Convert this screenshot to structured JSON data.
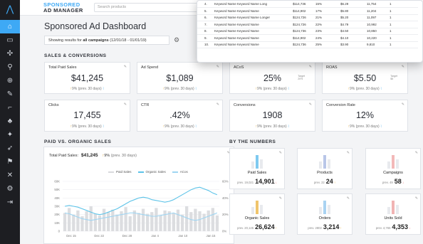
{
  "sidebar": {
    "icons": [
      "home-icon",
      "monitor-icon",
      "network-icon",
      "search-icon",
      "target-icon",
      "wrench-icon",
      "telescope-icon",
      "tree-icon",
      "bookmark-icon",
      "rocket-icon",
      "flag-icon",
      "split-icon",
      "gear-icon",
      "exit-icon"
    ]
  },
  "brand": {
    "line1": "SPONSORED",
    "line2": "AD MANAGER"
  },
  "search": {
    "placeholder": "Search products"
  },
  "page": {
    "title": "Sponsored Ad Dashboard",
    "range_prefix": "Showing results for",
    "range_bold": "all campaigns",
    "range_dates": "(12/01/18 - 01/01/19)"
  },
  "sections": {
    "sales": "SALES & CONVERSIONS",
    "paid": "PAID VS. ORGANIC SALES",
    "numbers": "BY THE NUMBERS"
  },
  "kpis": [
    {
      "label": "Total Paid Sales",
      "value": "$41,245",
      "change": "9%",
      "prev": "(prev. 30 days)"
    },
    {
      "label": "Ad Spend",
      "value": "$1,089",
      "change": "9%",
      "prev": "(prev. 30 days)"
    },
    {
      "label": "ACoS",
      "value": "25%",
      "target": "Target",
      "target_value": "20%",
      "change": "9%",
      "prev": "(prev. 30 days)"
    },
    {
      "label": "ROAS",
      "value": "$5.50",
      "target": "Target",
      "target_value": "$5",
      "change": "9%",
      "prev": "(prev. 30 days)"
    },
    {
      "label": "Clicks",
      "value": "17,455",
      "change": "9%",
      "prev": "(prev. 30 days)"
    },
    {
      "label": "CTR",
      "value": ".42%",
      "change": "9%",
      "prev": "(prev. 30 days)"
    },
    {
      "label": "Conversions",
      "value": "1908",
      "change": "9%",
      "prev": "(prev. 30 days)"
    },
    {
      "label": "Conversion Rate",
      "value": "12%",
      "change": "9%",
      "prev": "(prev. 30 days)"
    }
  ],
  "paid_chart": {
    "total_label": "Total Paid Sales:",
    "total_value": "$41,245",
    "change": "9%",
    "prev": "(prev. 30 days)"
  },
  "chart_data": {
    "type": "bar",
    "series": [
      {
        "name": "Paid Sales",
        "kind": "bar",
        "color": "#d9dadd"
      },
      {
        "name": "Organic Sales",
        "kind": "line",
        "color": "#5cc3e8"
      },
      {
        "name": "ACos",
        "kind": "line",
        "color": "#9fd5f2"
      }
    ],
    "ytick_labels": [
      "60K",
      "50K",
      "40K",
      "30K",
      "20K",
      "10K",
      "0"
    ],
    "ytick_values": [
      60,
      50,
      40,
      30,
      20,
      10,
      0
    ],
    "yr_labels": [
      "60%",
      "40%",
      "20%",
      "0%"
    ],
    "xtick_labels": [
      "Dec 15",
      "Dec 22",
      "Dec 28",
      "Jan 4",
      "Jan 10",
      "Jan 15"
    ],
    "bars": [
      22,
      28,
      20,
      25,
      18,
      24,
      30,
      21,
      19,
      27,
      23,
      26,
      20,
      24,
      29,
      18,
      25,
      22,
      27,
      21,
      23,
      28,
      19,
      25,
      24,
      22,
      26,
      20,
      30,
      23,
      27,
      24,
      21,
      25,
      28,
      19
    ],
    "organic": [
      30,
      31,
      30,
      29,
      27,
      25,
      23,
      21,
      20,
      21,
      23,
      25,
      27,
      30,
      33,
      36,
      38,
      40,
      41,
      40,
      38,
      37,
      36,
      35,
      36,
      38,
      41,
      44,
      47,
      50,
      52,
      53,
      51,
      49,
      46,
      44
    ],
    "acos": [
      22,
      21,
      19,
      17,
      15,
      14,
      13,
      14,
      15,
      16,
      17,
      18,
      19,
      20,
      21,
      22,
      22,
      21,
      20,
      19,
      18,
      18,
      19,
      20,
      21,
      22,
      20,
      18,
      16,
      14,
      13,
      14,
      16,
      18,
      20,
      22
    ]
  },
  "numbers": [
    {
      "label": "Paid Sales",
      "prev": "prev. 19,021",
      "value": "14,901",
      "trend": "down",
      "bar_color": "#7fcaf0"
    },
    {
      "label": "Products",
      "prev": "prev. 22",
      "value": "24",
      "trend": "up",
      "bar_color": "#b9c6e8"
    },
    {
      "label": "Campaigns",
      "prev": "prev. 49",
      "value": "58",
      "trend": "down",
      "bar_color": "#f3b9b9"
    },
    {
      "label": "Organic Sales",
      "prev": "prev. 20,145",
      "value": "26,624",
      "trend": "up",
      "bar_color": "#f0c56c"
    },
    {
      "label": "Orders",
      "prev": "prev. 2802",
      "value": "3,214",
      "trend": "up",
      "bar_color": "#a9d3f2"
    },
    {
      "label": "Units Sold",
      "prev": "prev. 4,765",
      "value": "4,353",
      "trend": "down",
      "bar_color": "#f1b4b4"
    }
  ],
  "keyword_table": [
    {
      "n": "4.",
      "kw": "Keyword Name Keyword Name Long",
      "a": "$114,736",
      "b": "15%",
      "c": "$6.29",
      "d": "11,754",
      "e": "1"
    },
    {
      "n": "5.",
      "kw": "Keyword Name Keyword Name",
      "a": "$114,902",
      "b": "17%",
      "c": "$5.80",
      "d": "11,204",
      "e": "1"
    },
    {
      "n": "6.",
      "kw": "Keyword Name Keyword Name Longer",
      "a": "$124,726",
      "b": "21%",
      "c": "$5.20",
      "d": "11,097",
      "e": "1"
    },
    {
      "n": "7.",
      "kw": "Keyword Name Keyword Name",
      "a": "$124,726",
      "b": "22%",
      "c": "$4.79",
      "d": "10,992",
      "e": "1"
    },
    {
      "n": "8.",
      "kw": "Keyword Name Keyword Name",
      "a": "$124,736",
      "b": "23%",
      "c": "$4.50",
      "d": "10,850",
      "e": "1"
    },
    {
      "n": "9.",
      "kw": "Keyword Name Keyword Name",
      "a": "$114,902",
      "b": "24%",
      "c": "$4.10",
      "d": "10,220",
      "e": "1"
    },
    {
      "n": "10.",
      "kw": "Keyword Name Keyword Name",
      "a": "$124,736",
      "b": "25%",
      "c": "$3.90",
      "d": "9,810",
      "e": "1"
    }
  ]
}
